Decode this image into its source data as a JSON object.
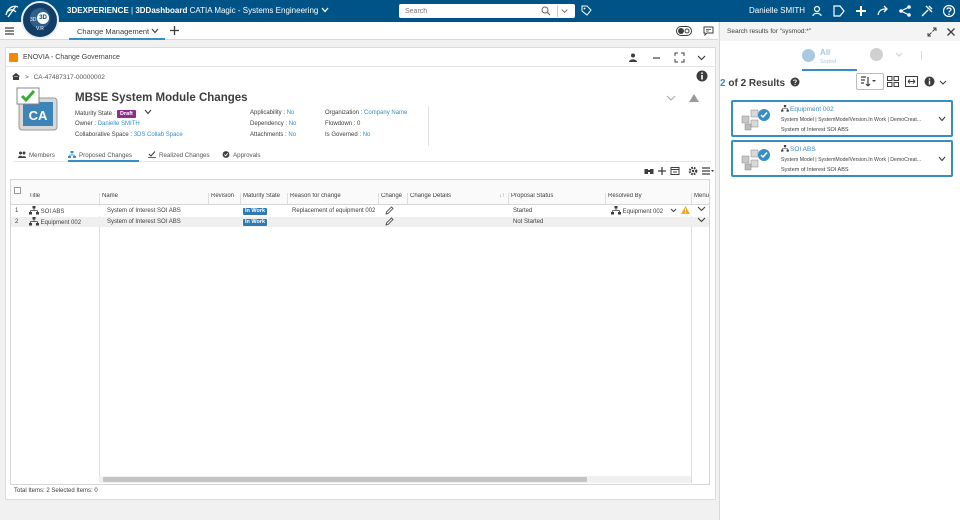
{
  "topbar": {
    "brand_bold": "3DEXPERIENCE",
    "brand_sep": " | ",
    "dashboard_bold": "3DDashboard",
    "app_name": " CATIA Magic - Systems Engineering",
    "search_placeholder": "Search",
    "user_name": "Danielle SMITH",
    "compass_center": "3D",
    "compass_left": "3D",
    "compass_bottom": "V.R"
  },
  "tabs": {
    "active_label": "Change Management"
  },
  "widget": {
    "title": "ENOVIA - Change Governance",
    "breadcrumb": "CA-47487317-00000002",
    "ca_label": "CA",
    "ca_title": "MBSE System Module Changes",
    "attrs": {
      "maturity_label": "Maturity State :",
      "maturity_value": "Draft",
      "owner_label": "Owner :",
      "owner_value": "Danielle SMITH",
      "collab_label": "Collaborative Space :",
      "collab_value": "3DS Collab Space",
      "applicability_label": "Applicability :",
      "applicability_value": "No",
      "dependency_label": "Dependency :",
      "dependency_value": "No",
      "attachments_label": "Attachments :",
      "attachments_value": "No",
      "organization_label": "Organization :",
      "organization_value": "Company Name",
      "flowdown_label": "Flowdown :",
      "flowdown_value": "0",
      "governed_label": "Is Governed :",
      "governed_value": "No"
    },
    "subtabs": [
      "Members",
      "Proposed Changes",
      "Realized Changes",
      "Approvals"
    ]
  },
  "grid": {
    "columns": [
      "Title",
      "Name",
      "Revision",
      "Maturity State",
      "Reason for change",
      "Change",
      "Change Details",
      "Proposal Status",
      "Resolved By",
      "Menu"
    ],
    "rows": [
      {
        "num": "1",
        "title": "SOI ABS",
        "name": "System of Interest SOI ABS",
        "revision": "",
        "maturity": "In Work",
        "reason": "Replacement of equipment 002",
        "details": "",
        "status": "Started",
        "resolved": "Equipment 002"
      },
      {
        "num": "2",
        "title": "Equipment 002",
        "name": "System of Interest SOI ABS",
        "revision": "",
        "maturity": "In Work",
        "reason": "",
        "details": "",
        "status": "Not Started",
        "resolved": ""
      }
    ],
    "footer": "Total Items: 2   Selected Items: 0"
  },
  "right_panel": {
    "title": "Search results for \"sysmod:*\"",
    "filter_all": "All",
    "filter_all_sub": "Sorted",
    "results_count": "2",
    "results_of": " of ",
    "results_total": "2",
    "results_label": " Results",
    "cards": [
      {
        "title": "Equipment 002",
        "meta": "System Model | SystemModelVersion.In Work | DemoCreat...",
        "sub": "System of Interest SOI ABS"
      },
      {
        "title": "SOI ABS",
        "meta": "System Model | SystemModelVersion.In Work | DemoCreat...",
        "sub": "System of Interest SOI ABS"
      }
    ]
  },
  "colors": {
    "topbar": "#005386",
    "accent": "#368ec4",
    "draft": "#8e2d8f",
    "inwork": "#2e7bb3",
    "enovia": "#f18a00",
    "warning": "#f5a623"
  }
}
